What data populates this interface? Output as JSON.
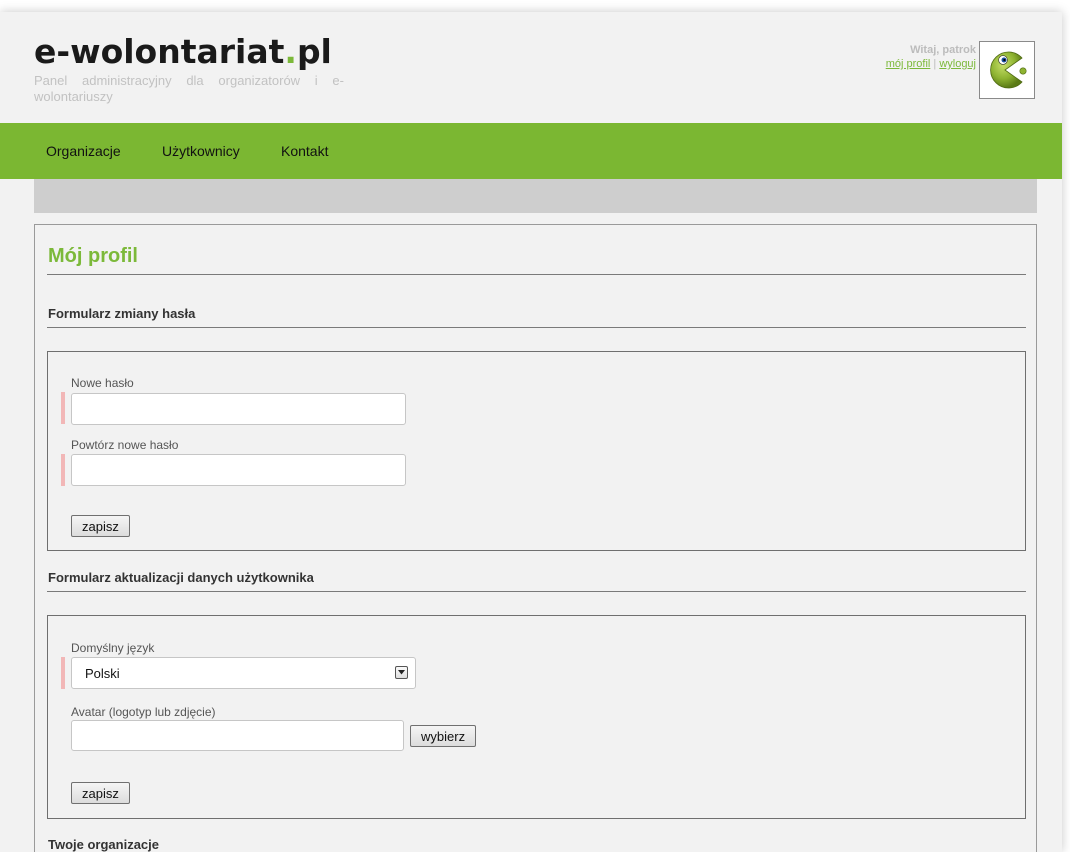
{
  "header": {
    "logo_main": "e-wolontariat",
    "logo_dot": ".",
    "logo_tld": "pl",
    "tagline": "Panel administracyjny dla organizatorów i e-wolontariuszy",
    "welcome": "Witaj, patrok",
    "profile_link": "mój profil",
    "separator": "|",
    "logout_link": "wyloguj",
    "avatar_icon": "pacman-icon"
  },
  "nav": {
    "items": [
      {
        "label": "Organizacje"
      },
      {
        "label": "Użytkownicy"
      },
      {
        "label": "Kontakt"
      }
    ]
  },
  "main": {
    "title": "Mój profil",
    "password_form": {
      "heading": "Formularz zmiany hasła",
      "new_password_label": "Nowe hasło",
      "new_password_value": "",
      "repeat_password_label": "Powtórz nowe hasło",
      "repeat_password_value": "",
      "save_label": "zapisz"
    },
    "user_form": {
      "heading": "Formularz aktualizacji danych użytkownika",
      "language_label": "Domyślny język",
      "language_value": "Polski",
      "avatar_label": "Avatar (logotyp lub zdjęcie)",
      "avatar_value": "",
      "choose_label": "wybierz",
      "save_label": "zapisz"
    },
    "orgs_heading": "Twoje organizacje"
  },
  "colors": {
    "accent": "#7cb93a",
    "navbar": "#7bb732",
    "subbar": "#cecece",
    "required_marker": "#f2b7b7"
  }
}
